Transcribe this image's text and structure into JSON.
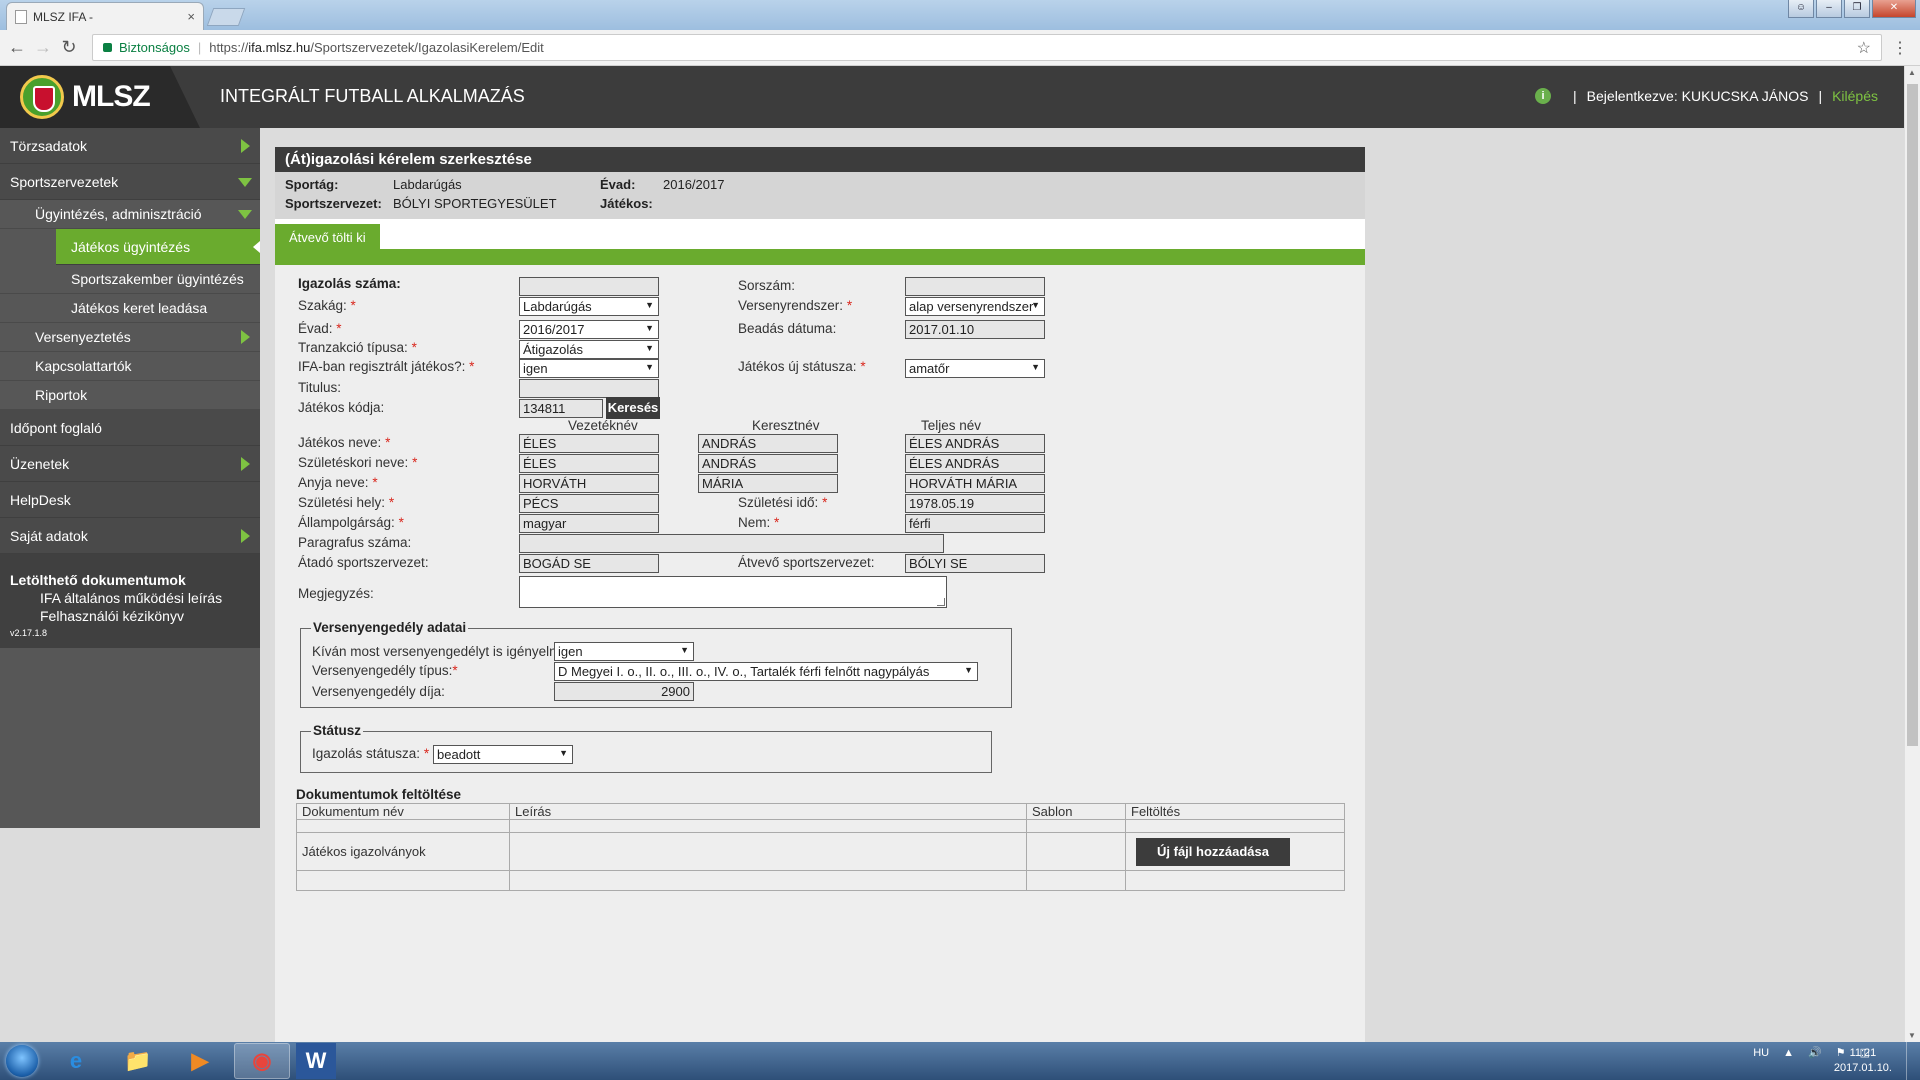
{
  "browser": {
    "tab_title": "MLSZ IFA -",
    "tab_close": "×",
    "secure_label": "Biztonságos",
    "url_prefix": "https://",
    "url_host": "ifa.mlsz.hu",
    "url_path": "/Sportszervezetek/IgazolasiKerelem/Edit"
  },
  "header": {
    "logo_text": "MLSZ",
    "app_title": "INTEGRÁLT FUTBALL ALKALMAZÁS",
    "info_icon": "i",
    "bar1": "|",
    "logged_in": "Bejelentkezve: KUKUCSKA JÁNOS",
    "bar2": "|",
    "logout": "Kilépés"
  },
  "sidebar": {
    "torzsadatok": "Törzsadatok",
    "sportszervezetek": "Sportszervezetek",
    "ugyintezes": "Ügyintézés, adminisztráció",
    "jatekos_ugyintezes": "Játékos ügyintézés",
    "sportszakember": "Sportszakember ügyintézés",
    "keret": "Játékos keret leadása",
    "versenyeztetes": "Versenyeztetés",
    "kapcsolattartok": "Kapcsolattartók",
    "riportok": "Riportok",
    "idopont": "Időpont foglaló",
    "uzenetek": "Üzenetek",
    "helpdesk": "HelpDesk",
    "sajat": "Saját adatok",
    "downloads_title": "Letölthető dokumentumok",
    "dl1": "IFA általános működési leírás",
    "dl2": "Felhasználói kézikönyv",
    "version": "v2.17.1.8"
  },
  "page": {
    "title": "(Át)igazolási kérelem szerkesztése",
    "sportag_label": "Sportág:",
    "sportag_value": "Labdarúgás",
    "evad_label": "Évad:",
    "evad_value": "2016/2017",
    "szervezet_label": "Sportszervezet:",
    "szervezet_value": "BÓLYI SPORTEGYESÜLET",
    "jatekos_label": "Játékos:",
    "tab": "Átvevő tölti ki"
  },
  "form": {
    "req": "*",
    "igazolas_szama_label": "Igazolás száma:",
    "igazolas_szama": "",
    "sorszam_label": "Sorszám:",
    "sorszam": "",
    "szakag_label": "Szakág:",
    "szakag": "Labdarúgás",
    "versenyrendszer_label": "Versenyrendszer:",
    "versenyrendszer": "alap versenyrendszer",
    "evad_label": "Évad:",
    "evad": "2016/2017",
    "beadas_label": "Beadás dátuma:",
    "beadas": "2017.01.10",
    "tranzakcio_label": "Tranzakció típusa:",
    "tranzakcio": "Átigazolás",
    "ifa_label": "IFA-ban regisztrált játékos?:",
    "ifa": "igen",
    "uj_statusz_label": "Játékos új státusza:",
    "uj_statusz": "amatőr",
    "titulus_label": "Titulus:",
    "titulus": "",
    "kod_label": "Játékos kódja:",
    "kod": "134811",
    "kereses": "Keresés",
    "col_vezeteknev": "Vezetéknév",
    "col_keresztnev": "Keresztnév",
    "col_teljes": "Teljes név",
    "nev_label": "Játékos neve:",
    "nev": [
      "ÉLES",
      "ANDRÁS",
      "ÉLES ANDRÁS"
    ],
    "szuletesi_nev_label": "Születéskori neve:",
    "szuletesi_nev": [
      "ÉLES",
      "ANDRÁS",
      "ÉLES ANDRÁS"
    ],
    "anyja_label": "Anyja neve:",
    "anyja": [
      "HORVÁTH",
      "MÁRIA",
      "HORVÁTH MÁRIA"
    ],
    "szul_hely_label": "Születési hely:",
    "szul_hely": "PÉCS",
    "szul_ido_label": "Születési idő:",
    "szul_ido": "1978.05.19",
    "allampolgarsag_label": "Állampolgárság:",
    "allampolgarsag": "magyar",
    "nem_label": "Nem:",
    "nem": "férfi",
    "paragrafus_label": "Paragrafus száma:",
    "paragrafus": "",
    "atado_label": "Átadó sportszervezet:",
    "atado": "BOGÁD SE",
    "atvevo_label": "Átvevő sportszervezet:",
    "atvevo": "BÓLYI SE",
    "megjegyzes_label": "Megjegyzés:"
  },
  "verseny": {
    "legend": "Versenyengedély adatai",
    "kivan_label": "Kíván most versenyengedélyt is igényelni?:",
    "kivan": "igen",
    "tipus_label": "Versenyengedély típus:",
    "tipus": "D Megyei I. o., II. o., III. o., IV. o., Tartalék férfi felnőtt nagypályás",
    "dij_label": "Versenyengedély díja:",
    "dij": "2900"
  },
  "statusz": {
    "legend": "Státusz",
    "label": "Igazolás státusza:",
    "value": "beadott"
  },
  "docs": {
    "title": "Dokumentumok feltöltése",
    "headers": [
      "Dokumentum név",
      "Leírás",
      "Sablon",
      "Feltöltés"
    ],
    "row1_name": "Játékos igazolványok",
    "add_button": "Új fájl hozzáadása"
  },
  "taskbar": {
    "lang": "HU",
    "time": "11:21",
    "date": "2017.01.10."
  }
}
